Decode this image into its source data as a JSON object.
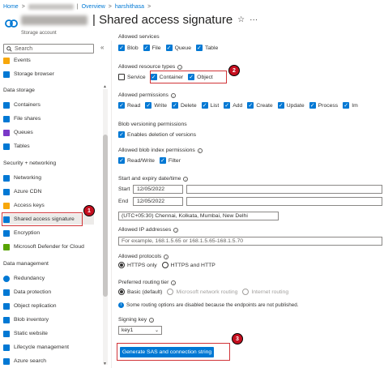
{
  "breadcrumb": {
    "home": "Home",
    "sep": ">",
    "overview": "Overview",
    "account": "harshithasa"
  },
  "header": {
    "title": "| Shared access signature",
    "subtitle": "Storage account",
    "star_icon": "☆",
    "more_icon": "···"
  },
  "sidebar": {
    "search_placeholder": "Search",
    "collapse": "«",
    "items_top": [
      {
        "label": "Events",
        "icon": "bolt-icon",
        "color": "#f7a70a"
      },
      {
        "label": "Storage browser",
        "icon": "folder-icon",
        "color": "#0078d4"
      }
    ],
    "section_data_storage": "Data storage",
    "items_data": [
      {
        "label": "Containers",
        "icon": "container-icon",
        "color": "#0078d4"
      },
      {
        "label": "File shares",
        "icon": "file-share-icon",
        "color": "#0078d4"
      },
      {
        "label": "Queues",
        "icon": "queue-icon",
        "color": "#7a38c8"
      },
      {
        "label": "Tables",
        "icon": "table-icon",
        "color": "#0078d4"
      }
    ],
    "section_security": "Security + networking",
    "items_security": [
      {
        "label": "Networking",
        "icon": "network-icon",
        "color": "#0078d4"
      },
      {
        "label": "Azure CDN",
        "icon": "cdn-icon",
        "color": "#0078d4"
      },
      {
        "label": "Access keys",
        "icon": "key-icon",
        "color": "#f7a70a"
      },
      {
        "label": "Shared access signature",
        "icon": "link-icon",
        "color": "#0078d4"
      },
      {
        "label": "Encryption",
        "icon": "lock-icon",
        "color": "#0078d4"
      },
      {
        "label": "Microsoft Defender for Cloud",
        "icon": "shield-icon",
        "color": "#57a300"
      }
    ],
    "section_data_mgmt": "Data management",
    "items_mgmt": [
      {
        "label": "Redundancy",
        "icon": "globe-icon",
        "color": "#0078d4"
      },
      {
        "label": "Data protection",
        "icon": "data-protection-icon",
        "color": "#0078d4"
      },
      {
        "label": "Object replication",
        "icon": "replication-icon",
        "color": "#0078d4"
      },
      {
        "label": "Blob inventory",
        "icon": "inventory-icon",
        "color": "#0078d4"
      },
      {
        "label": "Static website",
        "icon": "website-icon",
        "color": "#0078d4"
      },
      {
        "label": "Lifecycle management",
        "icon": "lifecycle-icon",
        "color": "#0078d4"
      },
      {
        "label": "Azure search",
        "icon": "cloud-icon",
        "color": "#0078d4"
      }
    ]
  },
  "annotations": {
    "badge1": "1",
    "badge2": "2",
    "badge3": "3",
    "accent": "#d13438"
  },
  "main": {
    "services_label": "Allowed services",
    "services": [
      "Blob",
      "File",
      "Queue",
      "Table"
    ],
    "resource_types_label": "Allowed resource types",
    "resource_types": [
      {
        "label": "Service",
        "checked": false
      },
      {
        "label": "Container",
        "checked": true
      },
      {
        "label": "Object",
        "checked": true
      }
    ],
    "permissions_label": "Allowed permissions",
    "permissions": [
      "Read",
      "Write",
      "Delete",
      "List",
      "Add",
      "Create",
      "Update",
      "Process",
      "Im"
    ],
    "versioning_label": "Blob versioning permissions",
    "versioning_option": "Enables deletion of versions",
    "index_label": "Allowed blob index permissions",
    "index_options": [
      "Read/Write",
      "Filter"
    ],
    "dates_label": "Start and expiry date/time",
    "start_label": "Start",
    "start_value": "12/05/2022",
    "end_label": "End",
    "end_value": "12/05/2022",
    "timezone": "(UTC+05:30) Chennai, Kolkata, Mumbai, New Delhi",
    "ip_label": "Allowed IP addresses",
    "ip_placeholder": "For example, 168.1.5.65 or 168.1.5.65-168.1.5.70",
    "protocols_label": "Allowed protocols",
    "protocols": [
      {
        "label": "HTTPS only",
        "selected": true
      },
      {
        "label": "HTTPS and HTTP",
        "selected": false
      }
    ],
    "routing_label": "Preferred routing tier",
    "routing": [
      {
        "label": "Basic (default)",
        "selected": true,
        "disabled": false
      },
      {
        "label": "Microsoft network routing",
        "selected": false,
        "disabled": true
      },
      {
        "label": "Internet routing",
        "selected": false,
        "disabled": true
      }
    ],
    "routing_note": "Some routing options are disabled because the endpoints are not published.",
    "signing_label": "Signing key",
    "signing_value": "key1",
    "generate_button": "Generate SAS and connection string"
  }
}
